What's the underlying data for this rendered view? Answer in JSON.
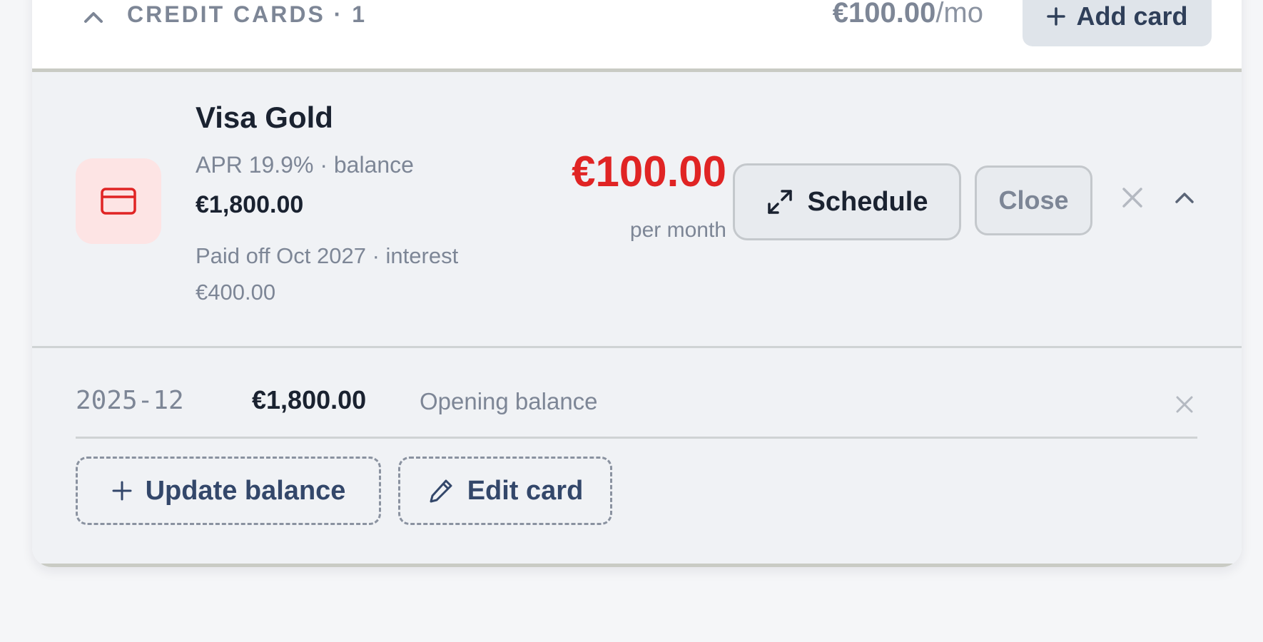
{
  "section": {
    "title": "CREDIT CARDS · 1",
    "total_amount": "€100.00",
    "total_suffix": "/mo",
    "add_label": "Add card"
  },
  "card": {
    "name": "Visa Gold",
    "meta": "APR 19.9% · balance",
    "balance": "€1,800.00",
    "payoff": "Paid off Oct 2027 · interest €400.00",
    "monthly": "€100.00",
    "per_month": "per month",
    "schedule_label": "Schedule",
    "close_label": "Close",
    "accent_color": "#e02424",
    "icon_bg": "#fde4e4"
  },
  "history": {
    "rows": [
      {
        "date": "2025-12",
        "amount": "€1,800.00",
        "label": "Opening balance"
      }
    ],
    "update_label": "Update balance",
    "edit_label": "Edit card"
  },
  "icons": {
    "section_toggle": "chevron-up-icon",
    "add": "plus-icon",
    "card": "credit-card-icon",
    "schedule": "expand-icon",
    "remove": "close-icon",
    "collapse": "chevron-up-icon",
    "edit": "pencil-icon"
  }
}
